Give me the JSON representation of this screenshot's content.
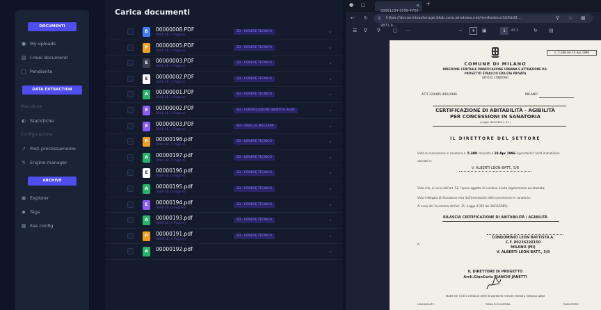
{
  "sidebar": {
    "sections": [
      {
        "head": "DOCUMENTI",
        "items": [
          {
            "label": "My uploads",
            "icon": "user-icon"
          },
          {
            "label": "I miei documenti",
            "icon": "document-icon"
          },
          {
            "label": "Pendiente",
            "icon": "clock-icon"
          }
        ]
      },
      {
        "head": "DATA EXTRACTION",
        "muted_1": "Marcature",
        "items": [
          {
            "label": "Statistiche",
            "icon": "chart-icon"
          }
        ],
        "muted_2": "Configurazione"
      },
      {
        "items": [
          {
            "label": "Post-processamento",
            "icon": "wand-icon"
          },
          {
            "label": "Engine manager",
            "icon": "bolt-icon"
          }
        ]
      },
      {
        "head": "ARCHIVE",
        "items": [
          {
            "label": "Explorer",
            "icon": "folder-icon"
          },
          {
            "label": "Tags",
            "icon": "tag-icon"
          },
          {
            "label": "Eas config",
            "icon": "grid-icon"
          }
        ]
      }
    ]
  },
  "list": {
    "title": "Carica documenti",
    "rows": [
      {
        "name": "00000008.PDF",
        "meta": "0000 kB (1 Pagine)",
        "tag": "SD - GENERE TECNICO",
        "color": "#3b7ef5",
        "letter": "B"
      },
      {
        "name": "00000005.PDF",
        "meta": "0000 kB (1 Pagine)",
        "tag": "SD - GENERE TECNICO",
        "color": "#f2a01c",
        "letter": "P"
      },
      {
        "name": "00000003.PDF",
        "meta": "0000 kB (1 Pagine)",
        "tag": "SD - GENERE TECNICO",
        "color": "#3a3f52",
        "letter": "E"
      },
      {
        "name": "00000002.PDF",
        "meta": "0000 kB (1 Pagine)",
        "tag": "SD - GENERE TECNICO",
        "color": "#ffffff",
        "letter": "E"
      },
      {
        "name": "00000001.PDF",
        "meta": "0000 kB (1 Pagine)",
        "tag": "SD - GENERE TECNICO",
        "color": "#26b46a",
        "letter": "A"
      },
      {
        "name": "00000002.PDF",
        "meta": "0000 kB (1 Pagine)",
        "tag": "SD - CERTIFICAZIONE IDENTITA AGIBI",
        "color": "#8b5cf6",
        "letter": "E"
      },
      {
        "name": "00000003.PDF",
        "meta": "0000 kB (1 Pagine)",
        "tag": "SD - TABELLE MILLESIMI",
        "color": "#8b5cf6",
        "letter": "E"
      },
      {
        "name": "00000198.pdf",
        "meta": "0000 kB (1 Pagine)",
        "tag": "SD - GENERE TECNICO",
        "color": "#f2a01c",
        "letter": "P"
      },
      {
        "name": "00000197.pdf",
        "meta": "0000 kB (1 Pagine)",
        "tag": "SD - GENERE TECNICO",
        "color": "#26b46a",
        "letter": "A"
      },
      {
        "name": "00000196.pdf",
        "meta": "0000 kB (1 Pagine)",
        "tag": "SD - GENERE TECNICO",
        "color": "#ffffff",
        "letter": "E"
      },
      {
        "name": "00000195.pdf",
        "meta": "0000 kB (1 Pagine)",
        "tag": "SD - GENERE TECNICO",
        "color": "#26b46a",
        "letter": "A"
      },
      {
        "name": "00000194.pdf",
        "meta": "0000 kB (1 Pagine)",
        "tag": "SD - GENERE TECNICO",
        "color": "#8b5cf6",
        "letter": "E"
      },
      {
        "name": "00000193.pdf",
        "meta": "0000 kB (1 Pagine)",
        "tag": "SD - GENERE TECNICO",
        "color": "#26b46a",
        "letter": "A"
      },
      {
        "name": "00000191.pdf",
        "meta": "0000 kB (1 Pagine)",
        "tag": "SD - GENERE TECNICO",
        "color": "#f2a01c",
        "letter": "P"
      },
      {
        "name": "00000192.pdf",
        "meta": "",
        "tag": "",
        "color": "#26b46a",
        "letter": "A"
      }
    ]
  },
  "browser": {
    "tab_title": "00001234-5556-4700-9871-9...",
    "url": "https://docuemisastorage.blob.core.windows.net/mediadocs/1b5dd3...",
    "page_current": "1",
    "page_total": "di 1"
  },
  "doc": {
    "ref": "n. 5.388 del 10 Apr 1996",
    "comune": "COMUNE DI MILANO",
    "direzione": "DIREZIONE CENTRALE PIANIFICAZIONE URBANA E ATTUAZIONE P.R.",
    "progetto": "PROGETTO STRALCIO EDILIZIA PRIVATA",
    "ufficio": "UFFICIO CONDONO",
    "atti": "ATTI 124485.400/1986",
    "milano": "MILANO",
    "cert_line1": "CERTIFICAZIONE DI ABITABILITÀ - AGIBILITÀ",
    "cert_line2": "PER CONCESSIONI IN SANATORIA",
    "legge": "( Legge 28/2/1985 n. 47 )",
    "direttore": "IL DIRETTORE DEL SETTORE",
    "p1_a": "Vista la concessione in sanatoria n.",
    "p1_num": "5.388",
    "p1_b": "rilasciata il",
    "p1_date": "10 Apr 1996",
    "p1_c": "riguardante l'unità immobiliare",
    "p1_d": "ubicata in:",
    "address": "V. ALBERTI LEON BATT., 5/8",
    "p2": "Visto che, ai sensi dell'art. 52, l'opera oggetto di condono risulta regolarmente accatastata;",
    "p3": "Vista l'allegata dichiarazione resa dall'intestatario della concessione in sanatoria;",
    "p4": "Ai sensi del 1a comma dell'art. 35, (legge 47/85 del 28/02/1985);",
    "rilascia": "RILASCIA CERTIFICAZIONE DI ABITABILITÀ / AGIBILITÀ",
    "a_mark": "A",
    "cond1": "CONDOMINIO LEON BATTISTA A.",
    "cond2": "C.F. 80226220150",
    "cond3": "MILANO (MI)",
    "cond4": "V. ALBERTI LEON BATT., 5/8",
    "ildp": "IL DIRETTORE DI PROGETTO",
    "arch": "Arch.GianCarlo BIANCHI JANETTI",
    "esatte": "Esatte lire 70.630 a titolo di diritti di segreteria rivenute erariali a rimborso spese",
    "foot1": "L'INCARICATO",
    "foot2": "FIRMA DI CHI RITIRA",
    "foot3": "DATA RITIRO"
  }
}
